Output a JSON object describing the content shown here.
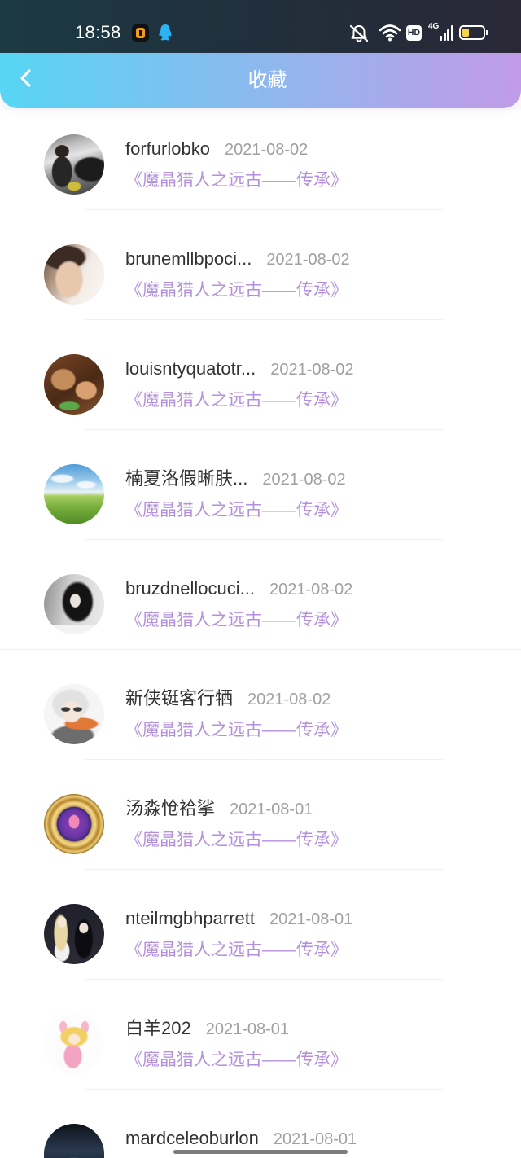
{
  "status_bar": {
    "time": "18:58",
    "app_icons": [
      "app-notification-icon",
      "qq-icon"
    ],
    "system_icons": [
      "mute-icon",
      "wifi-icon",
      "signal-icon",
      "battery-icon"
    ],
    "hd_label": "HD",
    "network_label": "4G",
    "signal_level": 4,
    "battery_level": 0.35
  },
  "header": {
    "back_icon": "chevron-left-icon",
    "title": "收藏"
  },
  "theme": {
    "header_gradient_start": "#57d6f4",
    "header_gradient_end": "#c29be8",
    "work_title_color": "#b48fde",
    "battery_fill_color": "#f6d548"
  },
  "favorites": [
    {
      "name": "forfurlobko",
      "date": "2021-08-02",
      "work_title": "《魔晶猎人之远古——传承》"
    },
    {
      "name": "brunemllbpoci...",
      "date": "2021-08-02",
      "work_title": "《魔晶猎人之远古——传承》"
    },
    {
      "name": "louisntyquatotr...",
      "date": "2021-08-02",
      "work_title": "《魔晶猎人之远古——传承》"
    },
    {
      "name": "楠夏洛假晰肤...",
      "date": "2021-08-02",
      "work_title": "《魔晶猎人之远古——传承》"
    },
    {
      "name": "bruzdnellocuci...",
      "date": "2021-08-02",
      "work_title": "《魔晶猎人之远古——传承》"
    },
    {
      "name": "新侠铤客行牺",
      "date": "2021-08-02",
      "work_title": "《魔晶猎人之远古——传承》"
    },
    {
      "name": "汤淼怆袷挲",
      "date": "2021-08-01",
      "work_title": "《魔晶猎人之远古——传承》"
    },
    {
      "name": "nteilmgbhparrett",
      "date": "2021-08-01",
      "work_title": "《魔晶猎人之远古——传承》"
    },
    {
      "name": "白羊202",
      "date": "2021-08-01",
      "work_title": "《魔晶猎人之远古——传承》"
    },
    {
      "name": "mardceleoburlon",
      "date": "2021-08-01"
    }
  ]
}
